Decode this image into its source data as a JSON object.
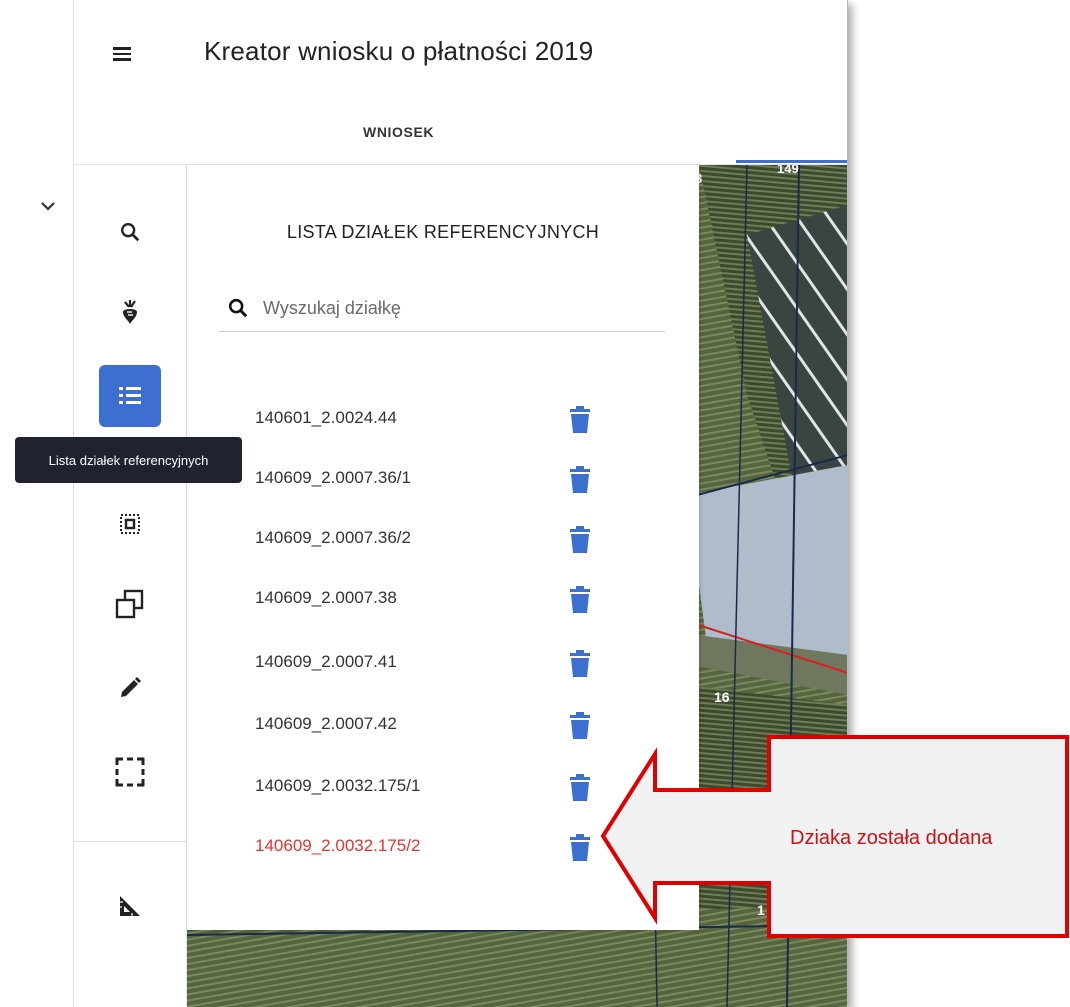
{
  "header": {
    "title": "Kreator wniosku o płatności 2019",
    "tab_label": "WNIOSEK"
  },
  "panel": {
    "title": "LISTA DZIAŁEK REFERENCYJNYCH",
    "search_placeholder": "Wyszukaj działkę",
    "parcels": [
      {
        "label": "140601_2.0024.44",
        "added": false
      },
      {
        "label": "140609_2.0007.36/1",
        "added": false
      },
      {
        "label": "140609_2.0007.36/2",
        "added": false
      },
      {
        "label": "140609_2.0007.38",
        "added": false
      },
      {
        "label": "140609_2.0007.41",
        "added": false
      },
      {
        "label": "140609_2.0007.42",
        "added": false
      },
      {
        "label": "140609_2.0032.175/1",
        "added": false
      },
      {
        "label": "140609_2.0032.175/2",
        "added": true
      }
    ]
  },
  "tooltip": {
    "text": "Lista działek referencyjnych"
  },
  "map_labels": {
    "a": "149",
    "b": "3",
    "c": "16",
    "d": "1"
  },
  "callout": {
    "text": "Dziaka została dodana"
  },
  "tools": [
    {
      "name": "search-tool",
      "icon": "search-icon"
    },
    {
      "name": "crops-tool",
      "icon": "beet-icon"
    },
    {
      "name": "parcel-list-tool",
      "icon": "list-icon",
      "active": true
    },
    {
      "name": "select-area-tool",
      "icon": "select-area-icon"
    },
    {
      "name": "copy-tool",
      "icon": "copy-icon"
    },
    {
      "name": "edit-tool",
      "icon": "pencil-icon"
    },
    {
      "name": "bounding-box-tool",
      "icon": "bounding-box-icon"
    },
    {
      "name": "measure-tool",
      "icon": "ruler-triangle-icon"
    }
  ],
  "colors": {
    "accent": "#3d6fd1",
    "added_parcel": "#e8322e",
    "callout_border": "#e00000"
  }
}
